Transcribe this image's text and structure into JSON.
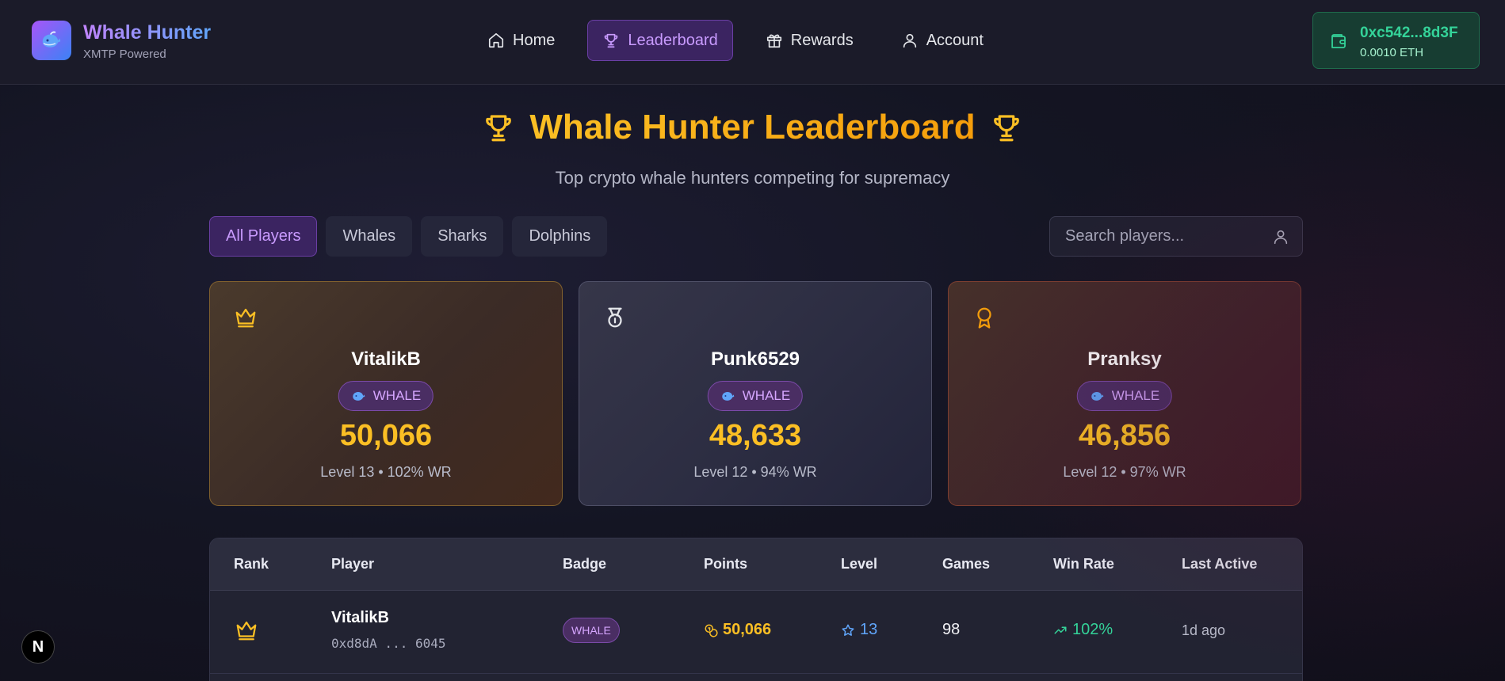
{
  "brand": {
    "title": "Whale Hunter",
    "subtitle": "XMTP Powered"
  },
  "nav": [
    {
      "label": "Home",
      "icon": "home-icon",
      "active": false
    },
    {
      "label": "Leaderboard",
      "icon": "trophy-icon",
      "active": true
    },
    {
      "label": "Rewards",
      "icon": "gift-icon",
      "active": false
    },
    {
      "label": "Account",
      "icon": "user-icon",
      "active": false
    }
  ],
  "wallet": {
    "address": "0xc542...8d3F",
    "balance": "0.0010 ETH"
  },
  "page": {
    "title": "Whale Hunter Leaderboard",
    "subtitle": "Top crypto whale hunters competing for supremacy"
  },
  "filters": [
    {
      "label": "All Players",
      "active": true
    },
    {
      "label": "Whales",
      "active": false
    },
    {
      "label": "Sharks",
      "active": false
    },
    {
      "label": "Dolphins",
      "active": false
    }
  ],
  "search": {
    "placeholder": "Search players..."
  },
  "podium": [
    {
      "name": "VitalikB",
      "badge": "WHALE",
      "points": "50,066",
      "meta": "Level 13 • 102% WR",
      "icon": "crown-icon"
    },
    {
      "name": "Punk6529",
      "badge": "WHALE",
      "points": "48,633",
      "meta": "Level 12 • 94% WR",
      "icon": "medal-icon"
    },
    {
      "name": "Pranksy",
      "badge": "WHALE",
      "points": "46,856",
      "meta": "Level 12 • 97% WR",
      "icon": "award-icon"
    }
  ],
  "table": {
    "headers": [
      "Rank",
      "Player",
      "Badge",
      "Points",
      "Level",
      "Games",
      "Win Rate",
      "Last Active"
    ],
    "rows": [
      {
        "name": "VitalikB",
        "address": "0xd8dA ... 6045",
        "badge": "WHALE",
        "points": "50,066",
        "level": "13",
        "games": "98",
        "win_rate": "102%",
        "last_active": "1d ago"
      }
    ]
  },
  "dev_badge": "N",
  "colors": {
    "accent": "#a855f7",
    "gold": "#fbbf24",
    "green": "#34d399",
    "blue": "#60a5fa"
  }
}
